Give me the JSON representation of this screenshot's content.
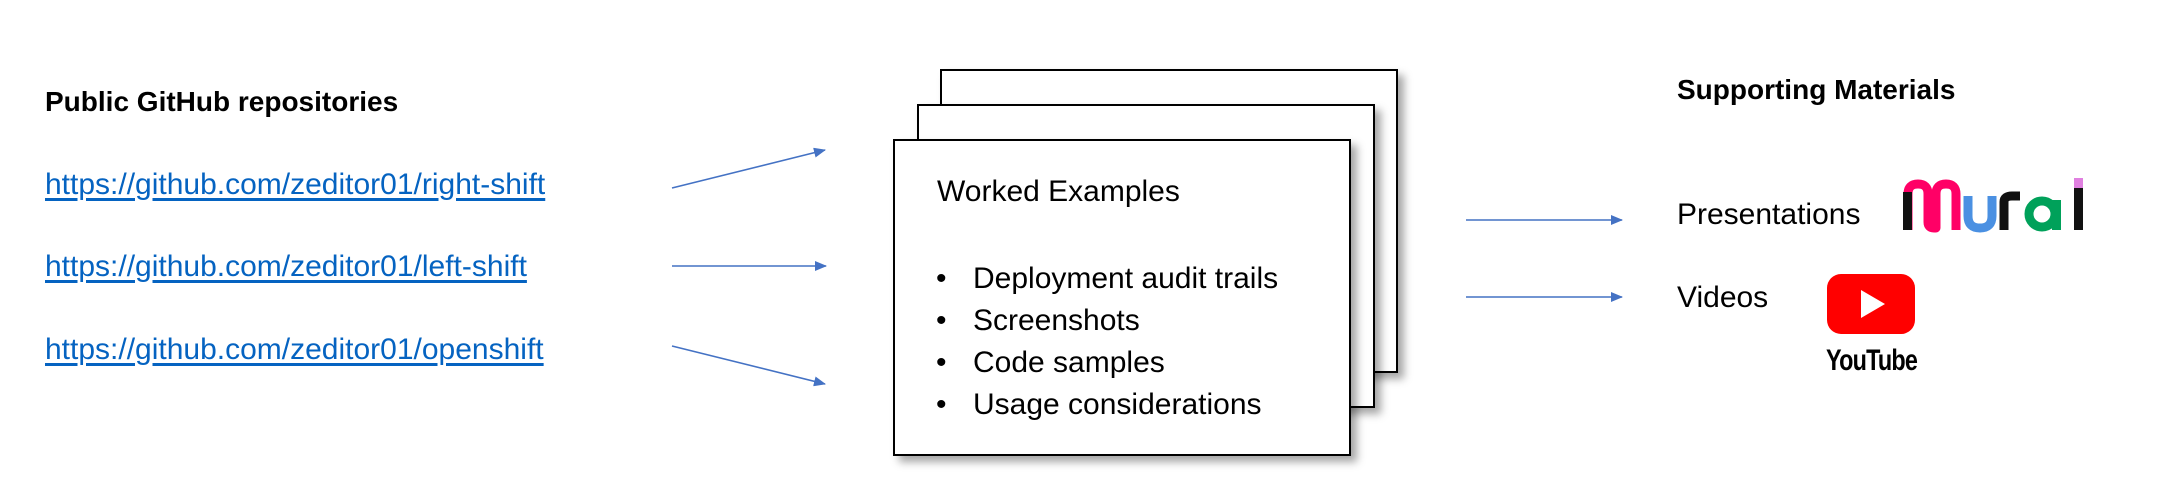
{
  "repositories": {
    "heading": "Public GitHub repositories",
    "links": [
      "https://github.com/zeditor01/right-shift",
      "https://github.com/zeditor01/left-shift",
      "https://github.com/zeditor01/openshift"
    ]
  },
  "worked_examples": {
    "title": "Worked Examples",
    "bullets": [
      "Deployment audit trails",
      "Screenshots",
      "Code samples",
      "Usage considerations"
    ]
  },
  "supporting_materials": {
    "heading": "Supporting Materials",
    "items": [
      {
        "label": "Presentations",
        "logo": "mural-logo"
      },
      {
        "label": "Videos",
        "logo": "youtube-logo",
        "logo_text": "YouTube"
      }
    ]
  },
  "colors": {
    "link": "#0563C1",
    "arrow": "#4472C4",
    "youtube_red": "#FF0000",
    "mural_red": "#FF0066",
    "mural_blue": "#4A90E2",
    "mural_green": "#00A15A"
  }
}
